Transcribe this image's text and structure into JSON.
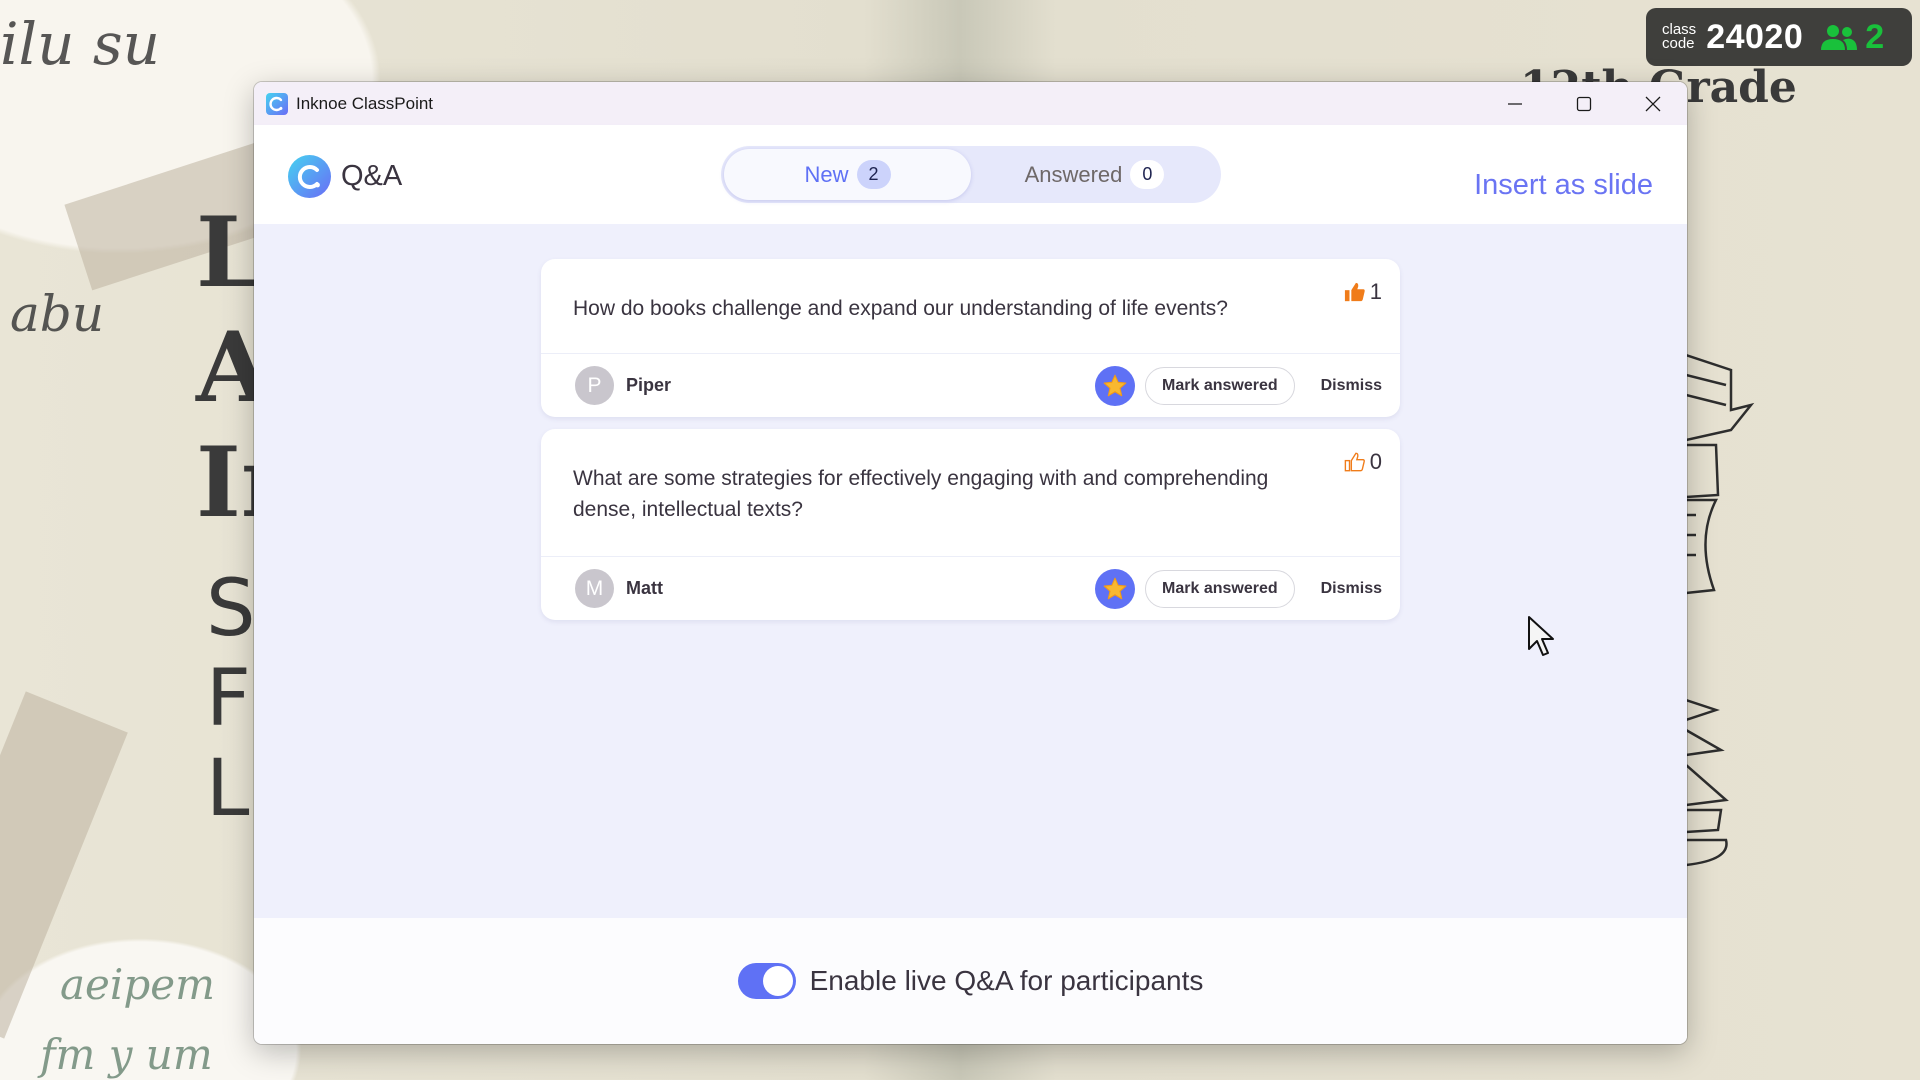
{
  "background_slide": {
    "title_fragments": [
      "Li",
      "A",
      "In"
    ],
    "subtitle_fragments": [
      "S",
      "F",
      "L"
    ],
    "grade_fragment": "12th Grade"
  },
  "class_badge": {
    "label_line1": "class",
    "label_line2": "code",
    "code": "24020",
    "participants_icon": "users-icon",
    "participants_count": "2",
    "accent_color": "#19c13b"
  },
  "window": {
    "app_title": "Inknoe ClassPoint",
    "controls": {
      "minimize": "minimize-icon",
      "maximize": "maximize-icon",
      "close": "close-icon"
    }
  },
  "header": {
    "title": "Q&A",
    "tabs": [
      {
        "label": "New",
        "count": "2",
        "active": true
      },
      {
        "label": "Answered",
        "count": "0",
        "active": false
      }
    ],
    "insert_label": "Insert as slide",
    "accent_color": "#5f71f5"
  },
  "questions": [
    {
      "text": "How do books challenge and expand our understanding of life events?",
      "votes": "1",
      "voted": true,
      "author": "Piper",
      "initial": "P",
      "mark_label": "Mark answered",
      "dismiss_label": "Dismiss"
    },
    {
      "text": "What are some strategies for effectively engaging with and comprehending dense, intellectual texts?",
      "votes": "0",
      "voted": false,
      "author": "Matt",
      "initial": "M",
      "mark_label": "Mark answered",
      "dismiss_label": "Dismiss"
    }
  ],
  "footer": {
    "toggle_label": "Enable live Q&A for participants",
    "toggle_on": true
  }
}
